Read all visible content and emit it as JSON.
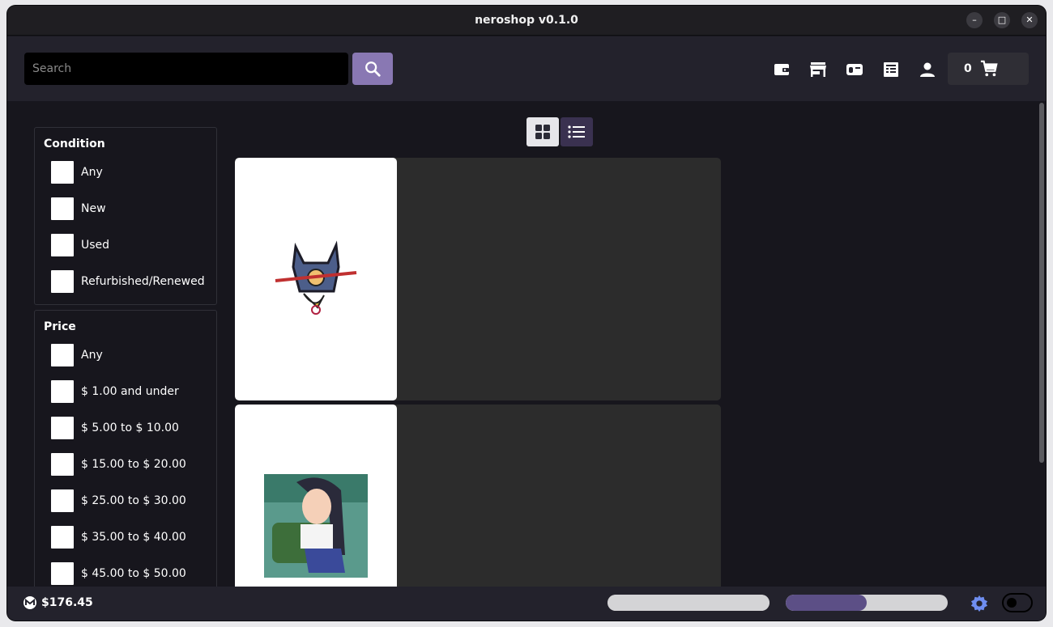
{
  "window": {
    "title": "neroshop v0.1.0"
  },
  "header": {
    "search_placeholder": "Search",
    "icons": [
      "wallet-icon",
      "store-icon",
      "inbox-icon",
      "orders-icon",
      "account-icon"
    ],
    "cart_count": "0"
  },
  "filters": {
    "condition": {
      "title": "Condition",
      "options": [
        "Any",
        "New",
        "Used",
        "Refurbished/Renewed"
      ]
    },
    "price": {
      "title": "Price",
      "options": [
        "Any",
        "$ 1.00 and under",
        "$ 5.00 to $ 10.00",
        "$ 15.00 to $ 20.00",
        "$ 25.00 to $ 30.00",
        "$ 35.00 to $ 40.00",
        "$ 45.00 to $ 50.00"
      ]
    }
  },
  "view_toggle": {
    "selected": "grid"
  },
  "products": [
    {
      "image": "cat-figure-thumbnail"
    },
    {
      "image": "anime-girl-thumbnail"
    }
  ],
  "footer": {
    "balance": "$176.45",
    "sync_progress_1": 1.0,
    "sync_progress_2": 0.5
  },
  "colors": {
    "accent": "#8978b3",
    "background": "#17161d",
    "header": "#23222c",
    "card": "#2c2c2c"
  }
}
